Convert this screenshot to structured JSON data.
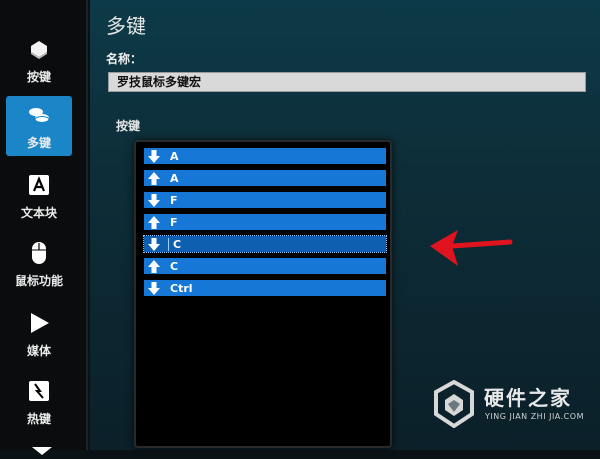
{
  "sidebar": {
    "items": [
      {
        "label": "按键",
        "icon": "key-icon"
      },
      {
        "label": "多键",
        "icon": "multikey-icon",
        "active": true
      },
      {
        "label": "文本块",
        "icon": "text-block-icon"
      },
      {
        "label": "鼠标功能",
        "icon": "mouse-icon"
      },
      {
        "label": "媒体",
        "icon": "media-play-icon"
      },
      {
        "label": "热键",
        "icon": "hotkey-icon"
      }
    ]
  },
  "main": {
    "title": "多键",
    "name_label": "名称：",
    "name_value": "罗技鼠标多键宏",
    "keys_label": "按键",
    "key_rows": [
      {
        "direction": "down",
        "key": "A"
      },
      {
        "direction": "up",
        "key": "A"
      },
      {
        "direction": "down",
        "key": "F"
      },
      {
        "direction": "up",
        "key": "F"
      },
      {
        "direction": "down",
        "key": "C",
        "selected": true
      },
      {
        "direction": "up",
        "key": "C"
      },
      {
        "direction": "down",
        "key": "Ctrl"
      }
    ]
  },
  "watermark": {
    "title": "硬件之家",
    "subtitle": "YING JIAN ZHI JIA.COM"
  },
  "colors": {
    "accent": "#1a86c7",
    "row": "#1677d6",
    "annotation_arrow": "#e0141e"
  }
}
